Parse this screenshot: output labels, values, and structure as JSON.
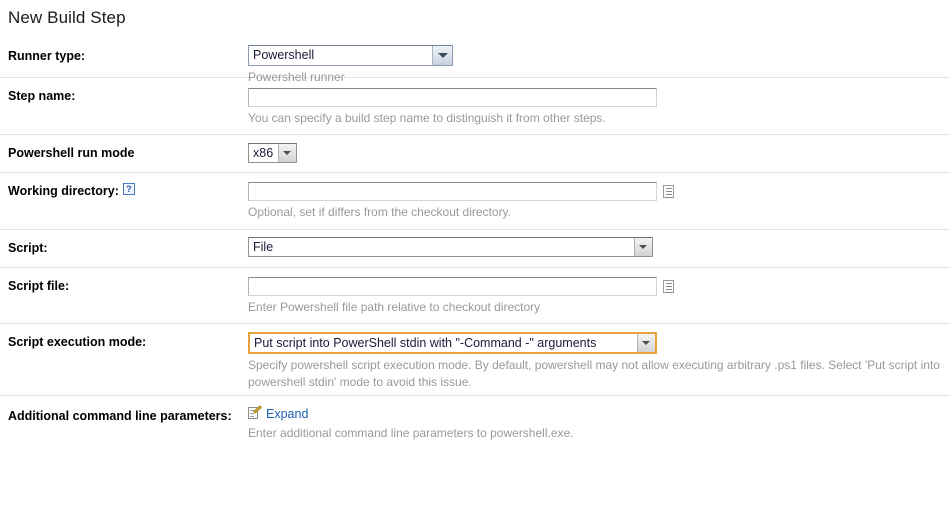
{
  "page": {
    "title": "New Build Step"
  },
  "fields": {
    "runner_type": {
      "label": "Runner type:",
      "selected": "Powershell",
      "options": [
        "Powershell"
      ],
      "hint": "Powershell runner"
    },
    "step_name": {
      "label": "Step name:",
      "value": "",
      "placeholder": "",
      "hint": "You can specify a build step name to distinguish it from other steps."
    },
    "run_mode": {
      "label": "Powershell run mode",
      "selected": "x86",
      "options": [
        "x86"
      ],
      "hint": ""
    },
    "working_directory": {
      "label": "Working directory:",
      "help_icon": "?",
      "value": "",
      "placeholder": "",
      "browse_icon": "document-browse-icon",
      "hint": "Optional, set if differs from the checkout directory."
    },
    "script": {
      "label": "Script:",
      "selected": "File",
      "options": [
        "File"
      ],
      "hint": ""
    },
    "script_file": {
      "label": "Script file:",
      "value": "",
      "placeholder": "",
      "browse_icon": "document-browse-icon",
      "hint": "Enter Powershell file path relative to checkout directory"
    },
    "script_execution_mode": {
      "label": "Script execution mode:",
      "selected": "Put script into PowerShell stdin with \"-Command -\" arguments",
      "options": [
        "Put script into PowerShell stdin with \"-Command -\" arguments"
      ],
      "hint": "Specify powershell script execution mode. By default, powershell may not allow executing arbitrary .ps1 files. Select 'Put script into powershell stdin' mode to avoid this issue.",
      "highlight_color": "#e8a33d"
    },
    "additional_params": {
      "label": "Additional command line parameters:",
      "expand_label": "Expand",
      "hint": "Enter additional command line parameters to powershell.exe."
    }
  },
  "colors": {
    "hint_text": "#999999",
    "link": "#1c5fb0",
    "separator": "#c8c8c8",
    "highlight": "#e8a33d"
  }
}
